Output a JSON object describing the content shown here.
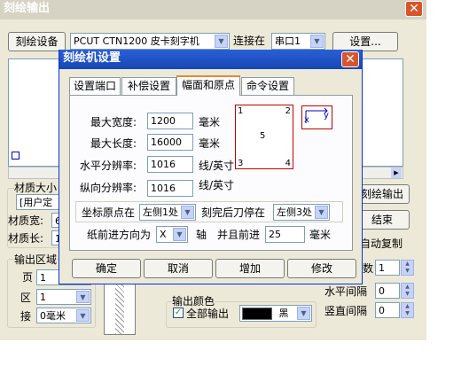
{
  "main_window": {
    "title": "刻绘输出",
    "close_glyph": "✕",
    "device_button": "刻绘设备",
    "device_select": "PCUT CTN1200 皮卡刻字机",
    "connect_label": "连接在",
    "port_select": "串口1",
    "settings_button": "设置...",
    "material_group": "材质大小",
    "material_select": "[用户定",
    "material_width_label": "材质宽:",
    "material_width_value": "6",
    "material_length_label": "材质长:",
    "material_length_value": "1",
    "output_area_group": "输出区域",
    "page_label": "页",
    "page_value": "1",
    "area_label": "区",
    "area_value": "1",
    "seam_label": "接",
    "seam_value": "0毫米",
    "engrave_output_button": "刻绘输出",
    "end_button": "结束",
    "auto_copy_label": "自动复制",
    "copies_label": "数",
    "copies_value": "1",
    "h_spacing_label": "水平间隔",
    "h_spacing_value": "0",
    "v_spacing_label": "竖直间隔",
    "v_spacing_value": "0",
    "output_color_group": "输出颜色",
    "all_output_label": "全部输出",
    "color_select": "黑",
    "checkmark_glyph": "✓"
  },
  "dialog": {
    "title": "刻绘机设置",
    "close_glyph": "✕",
    "tabs": [
      "设置端口",
      "补偿设置",
      "幅面和原点",
      "命令设置"
    ],
    "active_tab": 2,
    "max_width_label": "最大宽度:",
    "max_width_value": "1200",
    "max_length_label": "最大长度:",
    "max_length_value": "16000",
    "h_res_label": "水平分辨率:",
    "h_res_value": "1016",
    "v_res_label": "纵向分辨率:",
    "v_res_value": "1016",
    "unit_mm": "毫米",
    "unit_lpi": "线/英寸",
    "corner_1": "1",
    "corner_2": "2",
    "corner_3": "3",
    "corner_4": "4",
    "center_5": "5",
    "axis_x": "x",
    "axis_y": "y",
    "origin_label": "坐标原点在",
    "origin_value": "左侧1处",
    "stop_label": "刻完后刀停在",
    "stop_value": "左侧3处",
    "feed_dir_label": "纸前进方向为",
    "feed_dir_value": "X",
    "axis_label": "轴",
    "advance_label": "并且前进",
    "advance_value": "25",
    "confirm_button": "确定",
    "cancel_button": "取消",
    "add_button": "增加",
    "modify_button": "修改"
  },
  "colors": {
    "title_bar": "#1747b5",
    "window_bg": "#ece9d8",
    "close_button": "#d8552c",
    "preview_border": "#c00000",
    "preview_axis": "#0000c0"
  }
}
